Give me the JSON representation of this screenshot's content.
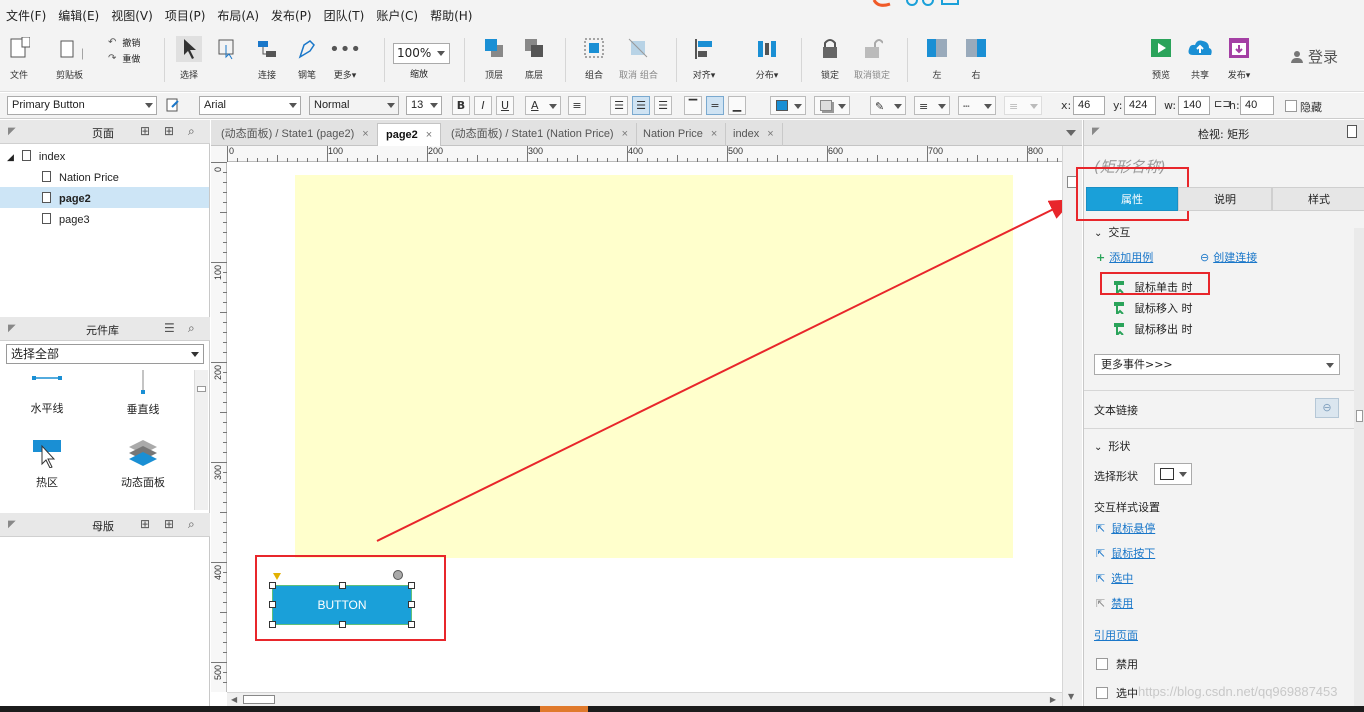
{
  "menu": [
    "文件(F)",
    "编辑(E)",
    "视图(V)",
    "项目(P)",
    "布局(A)",
    "发布(P)",
    "团队(T)",
    "账户(C)",
    "帮助(H)"
  ],
  "toolbar": {
    "file": "文件",
    "clipboard": "剪贴板",
    "undo": "撤销",
    "redo": "重做",
    "select": "选择",
    "connect": "连接",
    "pen": "钢笔",
    "more": "更多▾",
    "zoom_value": "100%",
    "zoom_label": "缩放",
    "top": "顶层",
    "bottom": "底层",
    "group": "组合",
    "ungroup": "取消 组合",
    "align": "对齐▾",
    "distribute": "分布▾",
    "lock": "锁定",
    "unlock": "取消锁定",
    "left": "左",
    "right": "右",
    "preview": "预览",
    "share": "共享",
    "publish": "发布▾",
    "login": "登录"
  },
  "format": {
    "widget_style": "Primary Button",
    "font_family": "Arial",
    "font_weight": "Normal",
    "font_size": "13",
    "bold": "B",
    "italic": "I",
    "underline": "U",
    "font_color": "A",
    "x_label": "x:",
    "x": "46",
    "y_label": "y:",
    "y": "424",
    "w_label": "w:",
    "w": "140",
    "h_label": "h:",
    "h": "40",
    "hidden_label": "隐藏"
  },
  "pages_panel": {
    "title": "页面",
    "root": "index",
    "children": [
      "Nation Price",
      "page2",
      "page3"
    ],
    "selected": "page2"
  },
  "library_panel": {
    "title": "元件库",
    "select_value": "选择全部",
    "items": [
      "水平线",
      "垂直线",
      "热区",
      "动态面板"
    ]
  },
  "masters_panel": {
    "title": "母版"
  },
  "tabs": [
    {
      "label": "(动态面板) / State1 (page2)",
      "active": false,
      "close": "×"
    },
    {
      "label": "page2",
      "active": true,
      "close": "×"
    },
    {
      "label": "(动态面板) / State1 (Nation Price)",
      "active": false,
      "close": "×"
    },
    {
      "label": "Nation Price",
      "active": false,
      "close": "×"
    },
    {
      "label": "index",
      "active": false,
      "close": "×"
    }
  ],
  "ruler": {
    "h": [
      "0",
      "100",
      "200",
      "300",
      "400",
      "500",
      "600",
      "700",
      "800"
    ],
    "v": [
      "0",
      "100",
      "200",
      "300",
      "400",
      "500"
    ]
  },
  "canvas": {
    "button_text": "BUTTON",
    "panel_color": "#ffffcc",
    "button_color": "#1aa0d9",
    "annotation_color": "#e8262b"
  },
  "inspector": {
    "title": "检视: 矩形",
    "name_placeholder": "(矩形名称)",
    "tabs": [
      "属性",
      "说明",
      "样式"
    ],
    "interaction_header": "交互",
    "add_case": "添加用例",
    "create_link": "创建连接",
    "events": [
      "鼠标单击 时",
      "鼠标移入 时",
      "鼠标移出 时"
    ],
    "more_events": "更多事件>>>",
    "text_link": "文本链接",
    "shape_header": "形状",
    "select_shape": "选择形状",
    "interaction_style": "交互样式设置",
    "styles": [
      "鼠标悬停",
      "鼠标按下",
      "选中",
      "禁用"
    ],
    "ref_page": "引用页面",
    "disabled": "禁用",
    "selected": "选中"
  },
  "watermark": "https://blog.csdn.net/qq969887453"
}
